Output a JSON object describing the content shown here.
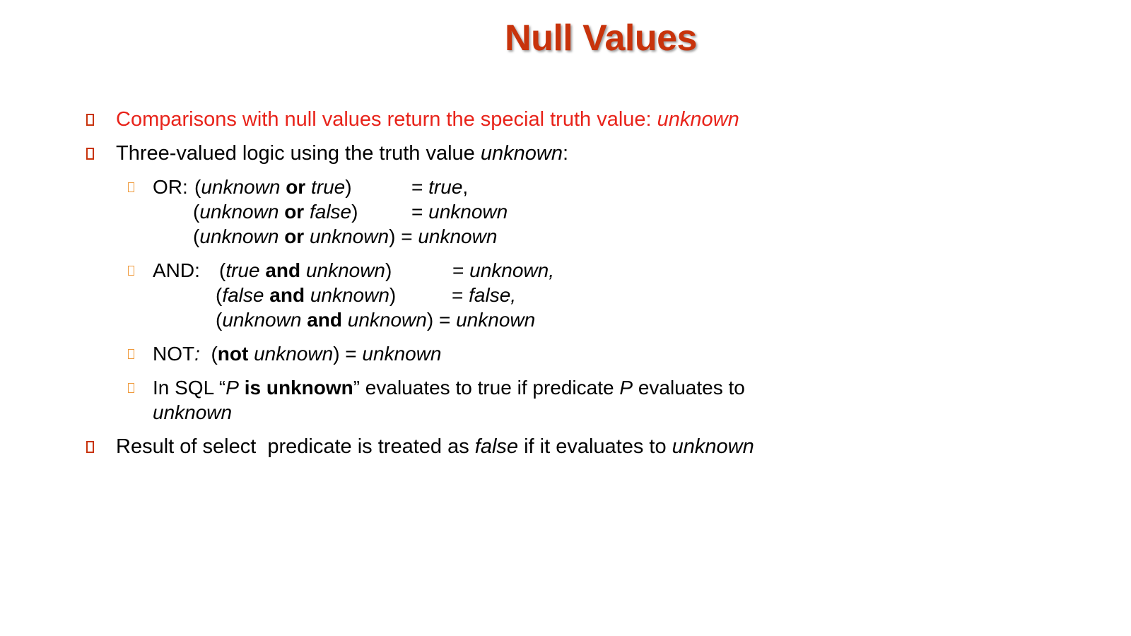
{
  "slide": {
    "title": "Null Values",
    "accent_color": "#c8330b",
    "subbullet_color": "#ef9a3c",
    "highlight_color": "#e8231a"
  },
  "bullets": {
    "comparisons": {
      "text": "Comparisons with null values return the special truth value: ",
      "emph": "unknown"
    },
    "three_valued": {
      "text": "Three-valued logic using the truth value ",
      "emph": "unknown",
      "tail": ":"
    },
    "or": {
      "label": "OR: ",
      "rows": [
        {
          "lp": "(",
          "a": "unknown",
          "op": "or",
          "b": "true",
          "rp": ")",
          "eq": "= ",
          "res": "true",
          "end": ","
        },
        {
          "lp": "(",
          "a": "unknown",
          "op": "or",
          "b": "false",
          "rp": ")",
          "eq": "= ",
          "res": "unknown",
          "end": ""
        },
        {
          "lp": "(",
          "a": "unknown",
          "op": "or",
          "b": "unknown",
          "rp": ") ",
          "eq": "= ",
          "res": "unknown",
          "end": ""
        }
      ]
    },
    "and": {
      "label": "AND:",
      "rows": [
        {
          "lp": "(",
          "a": "true",
          "op": "and",
          "b": "unknown",
          "rp": ")",
          "eq": "= ",
          "res": "unknown,",
          "end": ""
        },
        {
          "lp": "(",
          "a": "false",
          "op": "and",
          "b": "unknown",
          "rp": ")",
          "eq": "= ",
          "res": "false,",
          "end": ""
        },
        {
          "lp": "(",
          "a": "unknown",
          "op": "and",
          "b": "unknown",
          "rp": ") ",
          "eq": "= ",
          "res": "unknown",
          "end": ""
        }
      ]
    },
    "not": {
      "label": "NOT",
      "colon": ":",
      "lp": "(",
      "op": "not",
      "a": "unknown",
      "rp": ") = ",
      "res": "unknown"
    },
    "sql": {
      "t1": "In SQL “",
      "p": "P",
      "kw": "is unknown",
      "t2": "” evaluates to true if predicate ",
      "p2": "P",
      "t3": " evaluates to",
      "line2": "unknown"
    },
    "result": {
      "t1": "Result of select  predicate is treated as ",
      "e1": "false",
      "t2": " if it evaluates to ",
      "e2": "unknown"
    }
  }
}
